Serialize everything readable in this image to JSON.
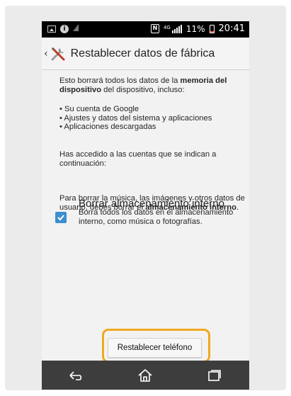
{
  "status_bar": {
    "left_icons": [
      "image-notification-icon",
      "info-notification-icon",
      "signal-small-icon"
    ],
    "nfc_label": "N",
    "network_label": "4G",
    "battery_percent": "11%",
    "time": "20:41"
  },
  "action_bar": {
    "title": "Restablecer datos de fábrica",
    "icon": "tools-icon"
  },
  "body": {
    "intro_start": "Esto borrará todos los datos de la ",
    "intro_bold": "memoria del dispositivo",
    "intro_end": " del dispositivo, incluso:",
    "list_items": [
      "• Su cuenta de Google",
      "• Ajustes y datos del sistema y aplicaciones",
      "• Aplicaciones descargadas"
    ],
    "accounts_text": "Has accedido a las cuentas que se indican a continuación:",
    "storage_start": "Para borrar la música, las imágenes y otros datos de usuario, debes borrar el ",
    "storage_bold": "almacenamiento interno",
    "storage_end": "."
  },
  "option": {
    "title": "Borrar almacenamiento interno",
    "description": "Borra todos los datos en el almacenamiento interno, como música o fotografías.",
    "checked": true
  },
  "reset_button": {
    "label": "Restablecer teléfono",
    "highlight_color": "#f0a820"
  },
  "nav_bar": {
    "buttons": [
      "back-icon",
      "home-icon",
      "recent-apps-icon"
    ]
  },
  "colors": {
    "accent": "#3b8fd0",
    "status_bar": "#000000",
    "nav_bar": "#3d3d3d"
  }
}
